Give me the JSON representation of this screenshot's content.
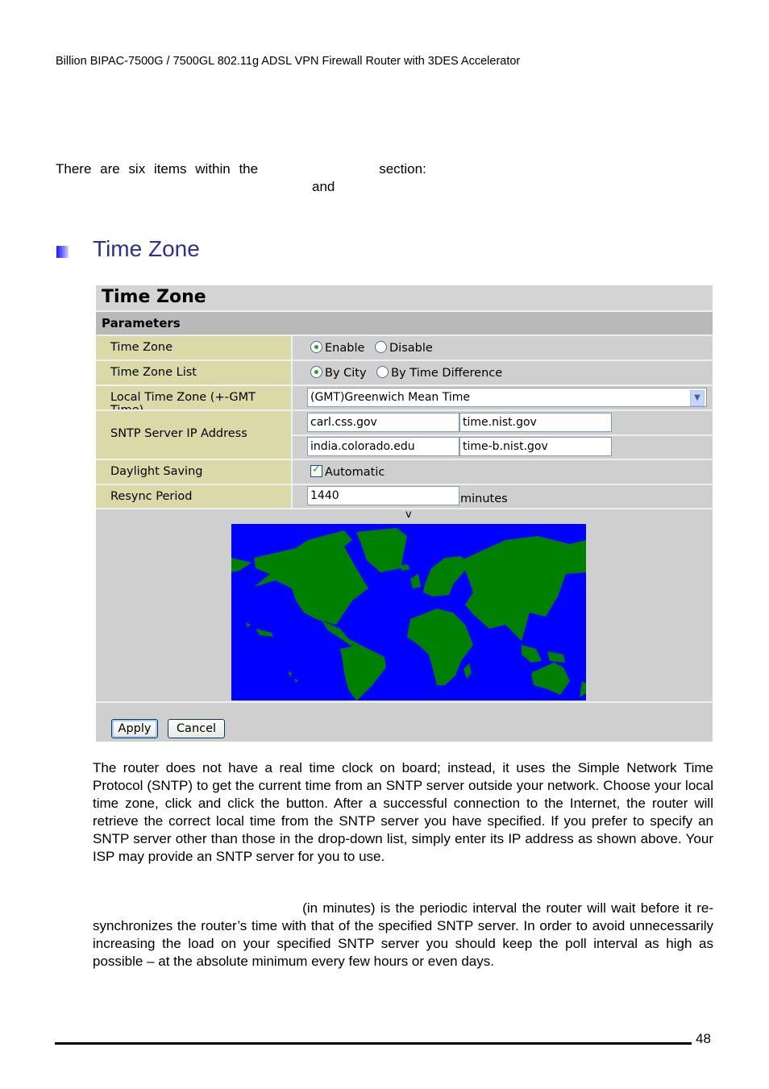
{
  "header": {
    "title": "Billion BIPAC-7500G / 7500GL 802.11g ADSL VPN Firewall Router with 3DES Accelerator"
  },
  "intro": {
    "line1": "There are six items within the              section:",
    "line2": "and"
  },
  "section": {
    "title": "Time Zone"
  },
  "panel": {
    "title": "Time Zone",
    "subtitle": "Parameters",
    "rows": {
      "time_zone": {
        "label": "Time Zone",
        "options": [
          "Enable",
          "Disable"
        ],
        "selected": "Enable"
      },
      "time_zone_list": {
        "label": "Time Zone List",
        "options": [
          "By City",
          "By Time Difference"
        ],
        "selected": "By City"
      },
      "local_time_zone": {
        "label": "Local Time Zone (+-GMT Time)",
        "value": "(GMT)Greenwich Mean Time"
      },
      "sntp": {
        "label": "SNTP Server IP Address",
        "servers": [
          "carl.css.gov",
          "time.nist.gov",
          "india.colorado.edu",
          "time-b.nist.gov"
        ]
      },
      "daylight": {
        "label": "Daylight Saving",
        "checkbox_label": "Automatic",
        "checked": true
      },
      "resync": {
        "label": "Resync Period",
        "value": "1440",
        "unit": "minutes"
      }
    },
    "map_marker": "v",
    "colors": {
      "ocean": "#0000ff",
      "land": "#008000",
      "label_cell": "#dcd9a9"
    },
    "buttons": {
      "apply": "Apply",
      "cancel": "Cancel"
    }
  },
  "body": {
    "para1": "The router does not have a real time clock on board; instead, it uses the Simple Network Time Protocol (SNTP) to get the current time from an SNTP server outside your network. Choose your local time zone, click            and click the           button. After a successful connection to the Internet, the router will retrieve the correct local time from the SNTP server you have specified. If you prefer to specify an SNTP server other than those in the drop-down list, simply enter its IP address as shown above. Your ISP may provide an SNTP server for you to use.",
    "para2": "                                         (in minutes) is the periodic interval the router will wait before it re-synchronizes the router’s time with that of the specified SNTP server. In order to avoid unnecessarily increasing the load on your specified SNTP server you should keep the poll interval as high as possible – at the absolute minimum every few hours or even days."
  },
  "footer": {
    "page_number": "48"
  }
}
